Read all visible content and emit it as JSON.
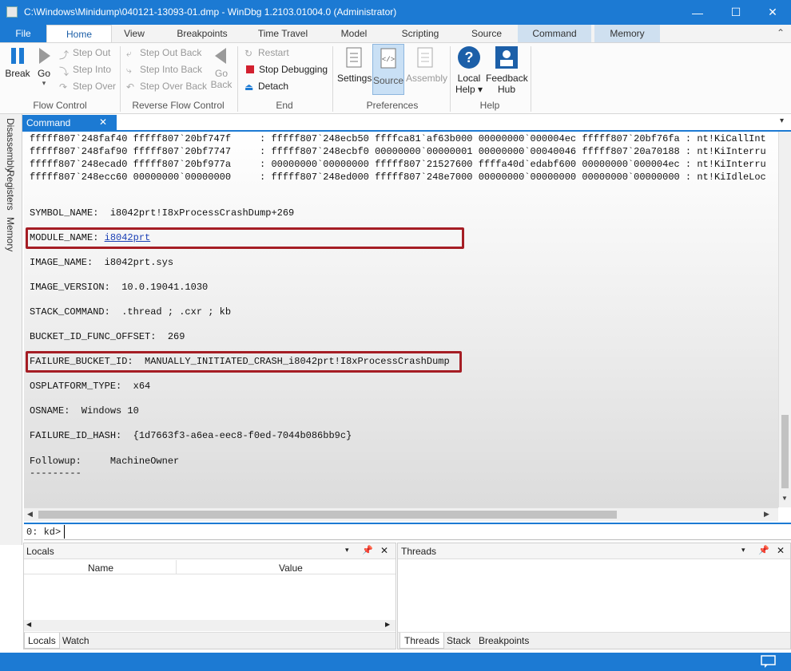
{
  "window": {
    "title": "C:\\Windows\\Minidump\\040121-13093-01.dmp - WinDbg 1.2103.01004.0 (Administrator)",
    "controls": {
      "minimize": "—",
      "maximize": "☐",
      "close": "✕"
    }
  },
  "ribbon": {
    "tabs": [
      "File",
      "Home",
      "View",
      "Breakpoints",
      "Time Travel",
      "Model",
      "Scripting",
      "Source",
      "Command",
      "Memory"
    ],
    "flow_control": {
      "break": "Break",
      "go": "Go",
      "step_out": "Step Out",
      "step_into": "Step Into",
      "step_over": "Step Over",
      "label": "Flow Control"
    },
    "reverse_flow": {
      "step_out_back": "Step Out Back",
      "step_into_back": "Step Into Back",
      "step_over_back": "Step Over Back",
      "go_back_1": "Go",
      "go_back_2": "Back",
      "label": "Reverse Flow Control"
    },
    "end": {
      "restart": "Restart",
      "stop": "Stop Debugging",
      "detach": "Detach",
      "label": "End"
    },
    "preferences": {
      "settings": "Settings",
      "source": "Source",
      "assembly": "Assembly",
      "label": "Preferences"
    },
    "help": {
      "local_help_1": "Local",
      "local_help_2": "Help ▾",
      "feedback_1": "Feedback",
      "feedback_2": "Hub",
      "label": "Help"
    }
  },
  "side_tabs": [
    "Disassembly",
    "Registers",
    "Memory"
  ],
  "command_window": {
    "tab_label": "Command",
    "stack_lines": [
      "fffff807`248faf40 fffff807`20bf747f     : fffff807`248ecb50 ffffca81`af63b000 00000000`000004ec fffff807`20bf76fa : nt!KiCallInt",
      "fffff807`248faf90 fffff807`20bf7747     : fffff807`248ecbf0 00000000`00000001 00000000`00040046 fffff807`20a70188 : nt!KiInterru",
      "fffff807`248ecad0 fffff807`20bf977a     : 00000000`00000000 fffff807`21527600 ffffa40d`edabf600 00000000`000004ec : nt!KiInterru",
      "fffff807`248ecc60 00000000`00000000     : fffff807`248ed000 fffff807`248e7000 00000000`00000000 00000000`00000000 : nt!KiIdleLoc"
    ],
    "symbol_name": "SYMBOL_NAME:  i8042prt!I8xProcessCrashDump+269",
    "module_name_key": "MODULE_NAME: ",
    "module_name_link": "i8042prt",
    "image_name": "IMAGE_NAME:  i8042prt.sys",
    "image_version": "IMAGE_VERSION:  10.0.19041.1030",
    "stack_command": "STACK_COMMAND:  .thread ; .cxr ; kb",
    "bucket_offset": "BUCKET_ID_FUNC_OFFSET:  269",
    "failure_bucket": "FAILURE_BUCKET_ID:  MANUALLY_INITIATED_CRASH_i8042prt!I8xProcessCrashDump",
    "os_platform": "OSPLATFORM_TYPE:  x64",
    "os_name": "OSNAME:  Windows 10",
    "failure_hash": "FAILURE_ID_HASH:  {1d7663f3-a6ea-eec8-f0ed-7044b086bb9c}",
    "followup": "Followup:     MachineOwner",
    "dashes": "---------",
    "prompt": "0: kd>",
    "highlight_color": "#a51d24"
  },
  "locals_pane": {
    "title": "Locals",
    "col_name": "Name",
    "col_value": "Value",
    "tabs": [
      "Locals",
      "Watch"
    ]
  },
  "threads_pane": {
    "title": "Threads",
    "tabs": [
      "Threads",
      "Stack",
      "Breakpoints"
    ]
  },
  "colors": {
    "accent": "#1c7ad3"
  }
}
